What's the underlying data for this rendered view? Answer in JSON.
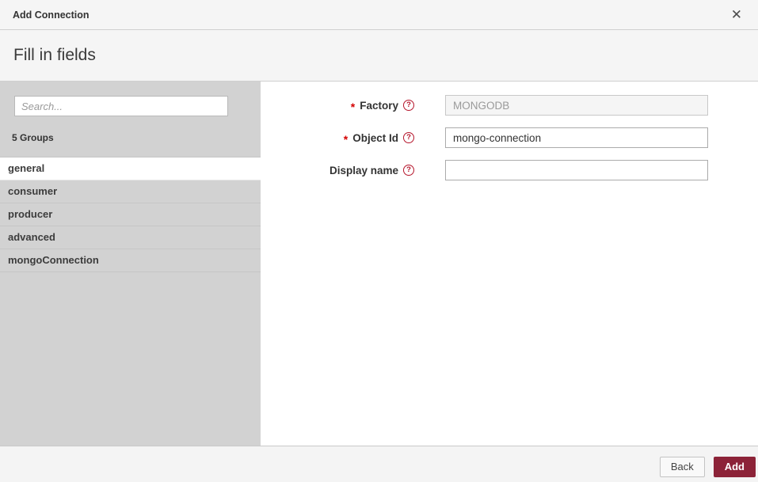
{
  "modal": {
    "title": "Add Connection",
    "heading": "Fill in fields"
  },
  "icons": {
    "close": "✕",
    "help": "?"
  },
  "sidebar": {
    "search_placeholder": "Search...",
    "groups_count_label": "5 Groups",
    "items": [
      {
        "label": "general",
        "selected": true
      },
      {
        "label": "consumer",
        "selected": false
      },
      {
        "label": "producer",
        "selected": false
      },
      {
        "label": "advanced",
        "selected": false
      },
      {
        "label": "mongoConnection",
        "selected": false
      }
    ]
  },
  "form": {
    "required_marker": "*",
    "fields": [
      {
        "label": "Factory",
        "required": true,
        "value": "MONGODB",
        "disabled": true
      },
      {
        "label": "Object Id",
        "required": true,
        "value": "mongo-connection",
        "disabled": false
      },
      {
        "label": "Display name",
        "required": false,
        "value": "",
        "disabled": false
      }
    ]
  },
  "footer": {
    "back_label": "Back",
    "add_label": "Add"
  },
  "colors": {
    "accent": "#8c2338",
    "help_icon": "#b5152b",
    "required_marker": "#d40000",
    "sidebar_bg": "#d2d2d2",
    "header_bg": "#f5f5f5",
    "footer_bg": "#f4f4f4"
  }
}
